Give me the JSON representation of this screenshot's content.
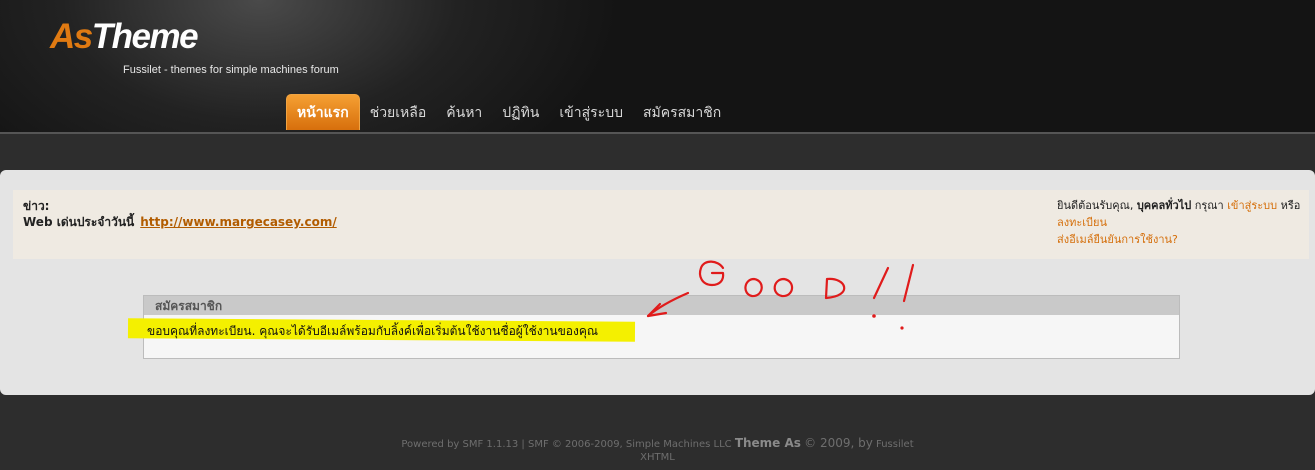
{
  "header": {
    "logo_part1": "As",
    "logo_part2": "Theme",
    "tagline": "Fussilet - themes for simple machines forum"
  },
  "nav": {
    "items": [
      {
        "label": "หน้าแรก",
        "active": true
      },
      {
        "label": "ช่วยเหลือ"
      },
      {
        "label": "ค้นหา"
      },
      {
        "label": "ปฏิทิน"
      },
      {
        "label": "เข้าสู่ระบบ"
      },
      {
        "label": "สมัครสมาชิก"
      }
    ]
  },
  "news": {
    "label": "ข่าว:",
    "text": "Web เด่นประจำวันนี้",
    "link": "http://www.margecasey.com/"
  },
  "user": {
    "welcome": "ยินดีต้อนรับคุณ, ",
    "guest": "บุคคลทั่วไป",
    "please": " กรุณา ",
    "login": "เข้าสู่ระบบ",
    "or": " หรือ",
    "register": "ลงทะเบียน",
    "resend": "ส่งอีเมล์ยืนยันการใช้งาน?"
  },
  "panel": {
    "title": "สมัครสมาชิก",
    "message": "ขอบคุณที่ลงทะเบียน. คุณจะได้รับอีเมล์พร้อมกับลิ้งค์เพื่อเริ่มต้นใช้งานชื่อผู้ใช้งานของคุณ"
  },
  "annotation": {
    "text": "GOOD!!",
    "color": "#e01b1b"
  },
  "footer": {
    "powered": "Powered by SMF 1.1.13",
    "sep": " | ",
    "smf": "SMF © 2006-2009, Simple Machines LLC",
    "theme": "Theme As",
    "year": "© 2009, by",
    "author": "Fussilet",
    "xhtml": "XHTML"
  },
  "colors": {
    "accent": "#e07a12",
    "highlight": "#f4f000",
    "header_bg": "#1a1a1a"
  }
}
